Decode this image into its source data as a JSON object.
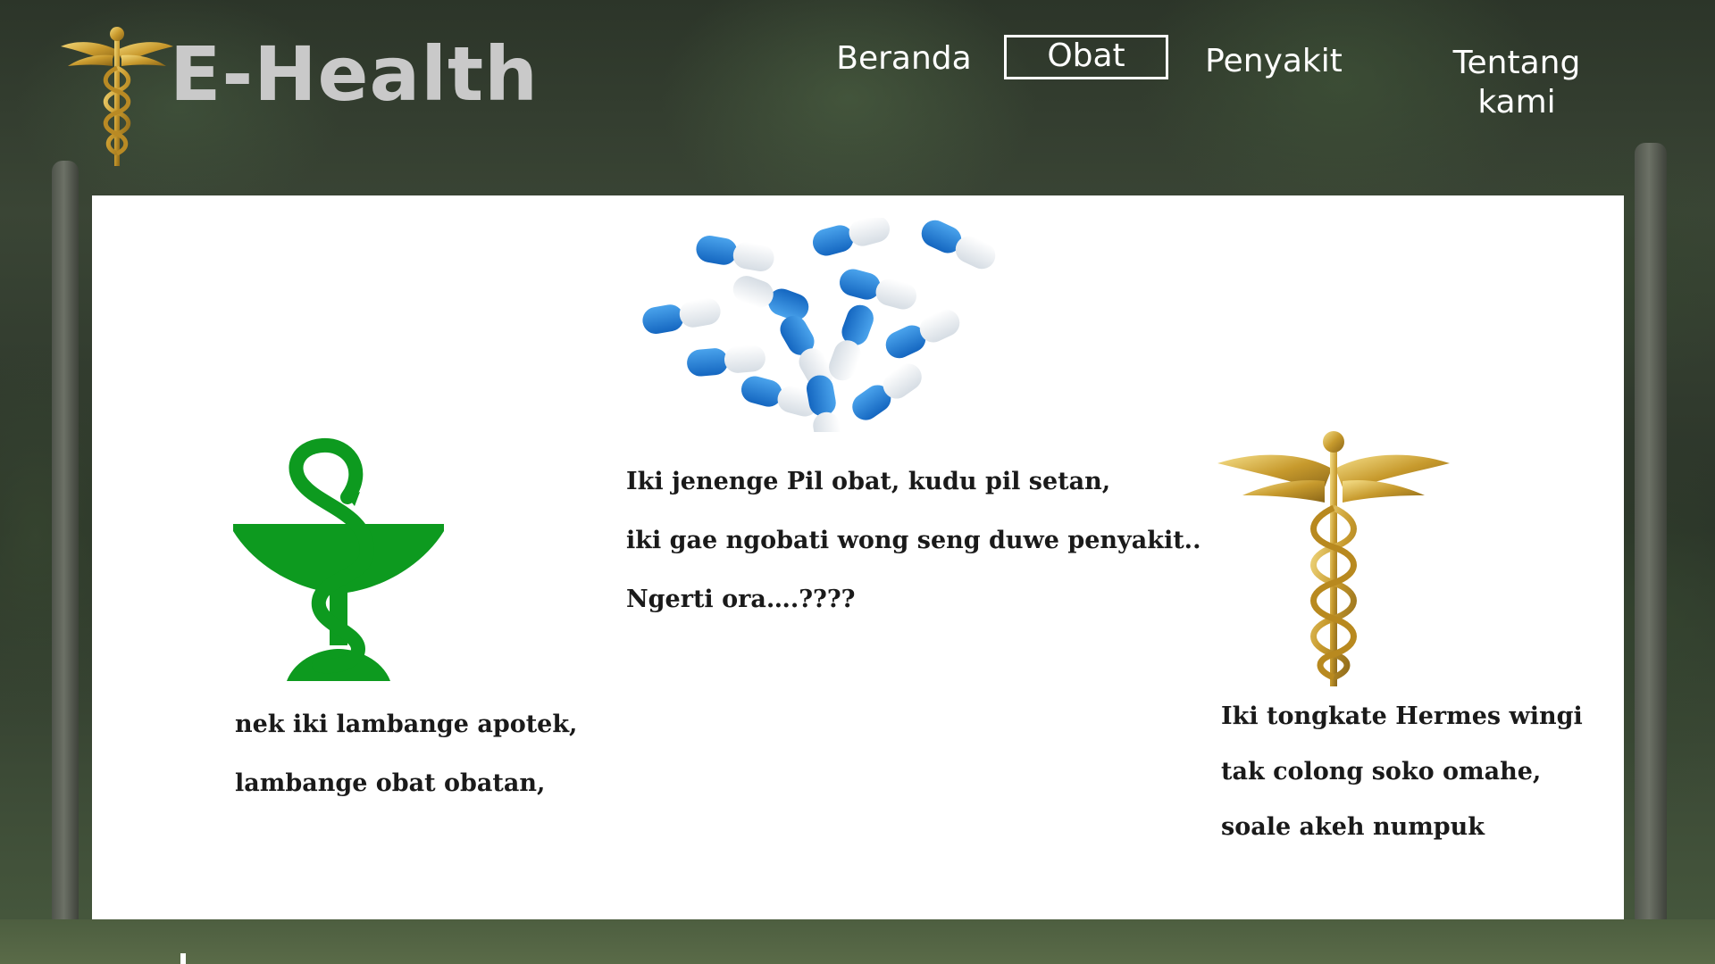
{
  "header": {
    "brand": "E-Health",
    "nav": [
      {
        "label": "Beranda",
        "active": false
      },
      {
        "label": "Obat",
        "active": true
      },
      {
        "label": "Penyakit",
        "active": false
      },
      {
        "label": "Tentang kami",
        "active": false
      }
    ]
  },
  "content": {
    "pills": {
      "lines": [
        "Iki jenenge Pil obat, kudu pil setan,",
        "iki gae ngobati wong seng duwe penyakit..",
        "Ngerti ora….????"
      ]
    },
    "apotek": {
      "lines": [
        "nek iki lambange apotek,",
        "lambange obat obatan,"
      ]
    },
    "hermes": {
      "lines": [
        "Iki tongkate Hermes wingi",
        "tak colong soko omahe,",
        "soale akeh numpuk"
      ]
    }
  },
  "icons": {
    "logo": "caduceus-icon",
    "pills": "capsules-icon",
    "apotek": "bowl-of-hygieia-icon",
    "hermes": "caduceus-icon"
  },
  "colors": {
    "brand_text": "#c9c9c9",
    "nav_text": "#ffffff",
    "panel_bg": "#ffffff",
    "apotek_green": "#0d9a1f",
    "gold": "#c9a23a",
    "capsule_blue": "#1f7fd6"
  }
}
